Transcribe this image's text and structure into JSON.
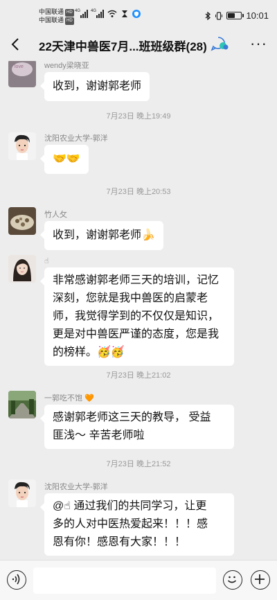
{
  "status_bar": {
    "carrier1": "中国联通",
    "carrier2": "中国联通",
    "hd_badge": "HD",
    "network1": "4G",
    "network2": "4G",
    "time": "10:01",
    "battery_percent": 55,
    "icons": [
      "signal-icon",
      "wifi-icon",
      "hourglass-icon",
      "shield-icon",
      "bluetooth-icon",
      "vibrate-icon",
      "battery-icon"
    ]
  },
  "header": {
    "title": "22天津中兽医7月...班班级群(28)",
    "icons": [
      "back-arrow-icon",
      "group-status-icon",
      "more-icon"
    ]
  },
  "messages": [
    {
      "sender": "wendy梁晓亚",
      "text": "收到，谢谢郭老师"
    },
    {
      "time": "7月23日 晚上19:49"
    },
    {
      "sender": "沈阳农业大学-郭洋",
      "text": "🤝🤝"
    },
    {
      "time": "7月23日 晚上20:53"
    },
    {
      "sender": "竹人攵",
      "text": "收到，谢谢郭老师🍌"
    },
    {
      "sender": "☝",
      "text": "非常感谢郭老师三天的培训，记忆深刻，您就是我中兽医的启蒙老师，我觉得学到的不仅仅是知识，更是对中兽医严谨的态度，您是我的榜样。🥳🥳"
    },
    {
      "time": "7月23日 晚上21:02"
    },
    {
      "sender": "一郭吃不饱 🧡",
      "text": "感谢郭老师这三天的教导，  受益匪浅～ 辛苦老师啦"
    },
    {
      "time": "7月23日 晚上21:52"
    },
    {
      "sender": "沈阳农业大学-郭洋",
      "text": "@☝ 通过我们的共同学习，让更多的人对中医热爱起来！！！感恩有你！感恩有大家！！！"
    }
  ],
  "bubble_lines": {
    "m6": [
      "非常感谢郭老师三天的培训，记忆",
      "深刻，您就是我中兽医的启蒙老",
      "师，我觉得学到的不仅仅是知识，",
      "更是对中兽医严谨的态度，您是我",
      "的榜样。🥳🥳"
    ],
    "m8": [
      "感谢郭老师这三天的教导，  受益",
      "匪浅～ 辛苦老师啦"
    ],
    "m10": [
      "@☝ 通过我们的共同学习，让更",
      "多的人对中医热爱起来！！！感",
      "恩有你！感恩有大家！！！"
    ]
  },
  "input_bar": {
    "icons": [
      "voice-icon",
      "emoji-icon",
      "plus-icon"
    ],
    "value": ""
  },
  "colors": {
    "background": "#ededed",
    "bubble": "#ffffff",
    "text": "#111111",
    "meta": "#999999",
    "accent": "#1e90ff"
  }
}
